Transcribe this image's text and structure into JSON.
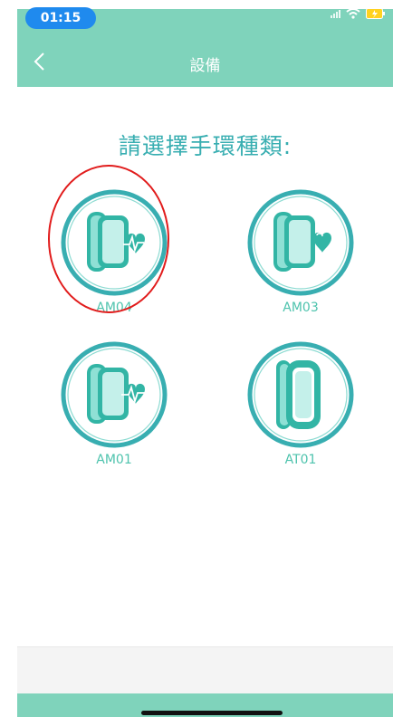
{
  "status": {
    "time": "01:15"
  },
  "nav": {
    "title": "設備",
    "back_icon": "chevron-left-icon"
  },
  "prompt": "請選擇手環種類:",
  "options": [
    {
      "label": "AM04",
      "icon": "band-heart-icon",
      "selected": true
    },
    {
      "label": "AM03",
      "icon": "band-heart-icon",
      "selected": false
    },
    {
      "label": "AM01",
      "icon": "band-heartbeat-icon",
      "selected": false
    },
    {
      "label": "AT01",
      "icon": "band-plain-icon",
      "selected": false
    }
  ],
  "colors": {
    "accent": "#7fd3bb",
    "teal": "#38aeb1",
    "selection": "#e11b1b"
  }
}
